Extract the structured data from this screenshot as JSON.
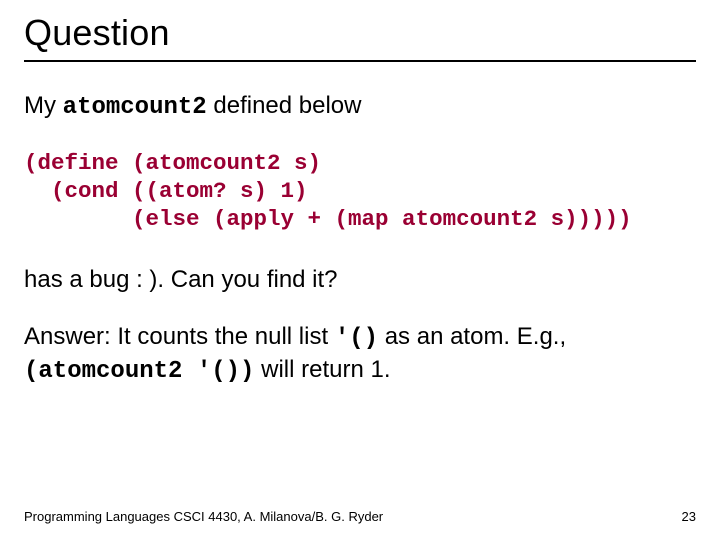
{
  "title": "Question",
  "intro": {
    "pre": "My ",
    "code": "atomcount2",
    "post": " defined below"
  },
  "code": {
    "l1": "(define (atomcount2 s)",
    "l2": "  (cond ((atom? s) 1)",
    "l3": "        (else (apply + (map atomcount2 s)))))"
  },
  "bug_line": "has a bug : ). Can you find it?",
  "answer": {
    "pre": "Answer: It counts the null list ",
    "code1": "'()",
    "mid": " as an atom. E.g., ",
    "code2": "(atomcount2 '())",
    "post": " will return 1."
  },
  "footer": "Programming Languages CSCI 4430, A. Milanova/B. G. Ryder",
  "page": "23"
}
